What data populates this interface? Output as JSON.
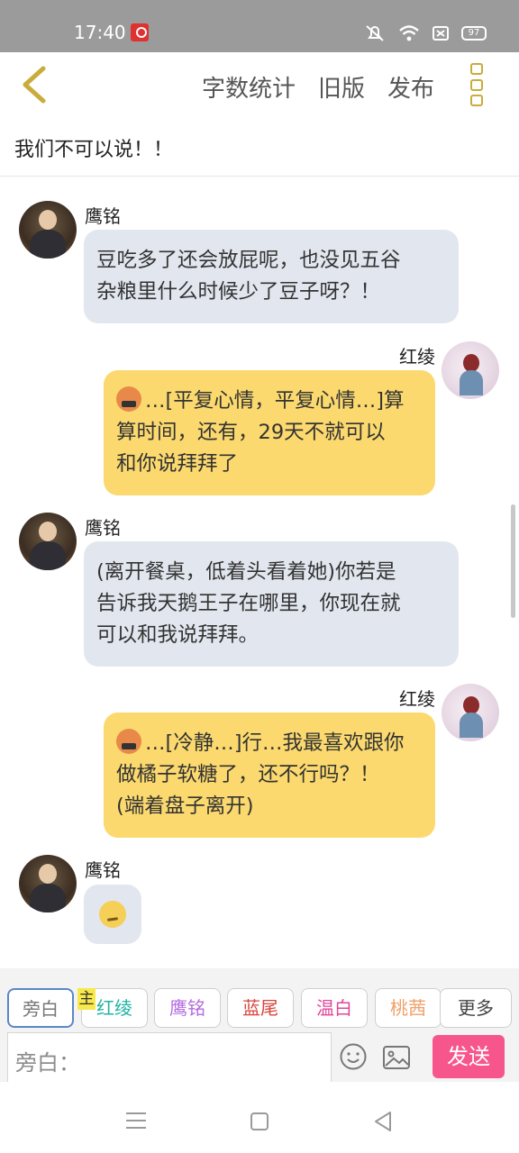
{
  "status_bar": {
    "time": "17:40",
    "battery": "97",
    "icons": [
      "app-notification-icon",
      "mute-icon",
      "wifi-icon",
      "sim-icon",
      "battery-icon"
    ]
  },
  "nav": {
    "word_count": "字数统计",
    "old_version": "旧版",
    "publish": "发布"
  },
  "title": "我们不可以说！！",
  "messages": [
    {
      "side": "left",
      "name": "鹰铭",
      "lines": [
        "豆吃多了还会放屁呢，也没见五谷",
        "杂粮里什么时候少了豆子呀？！"
      ]
    },
    {
      "side": "right",
      "name": "红绫",
      "emoji": "angry-emoji",
      "lines": [
        "…[平复心情，平复心情…]算",
        "算时间，还有，29天不就可以",
        "和你说拜拜了"
      ]
    },
    {
      "side": "left",
      "name": "鹰铭",
      "lines": [
        "(离开餐桌，低着头看着她)你若是",
        "告诉我天鹅王子在哪里，你现在就",
        "可以和我说拜拜。"
      ]
    },
    {
      "side": "right",
      "name": "红绫",
      "emoji": "angry-emoji",
      "lines": [
        "…[冷静…]行…我最喜欢跟你",
        "做橘子软糖了，还不行吗？！",
        "(端着盘子离开)"
      ]
    },
    {
      "side": "left",
      "name": "鹰铭",
      "emoji": "smirk-emoji",
      "lines": []
    }
  ],
  "roles": [
    {
      "label": "旁白",
      "color": "#777777"
    },
    {
      "label": "红绫",
      "color": "#22b3a4"
    },
    {
      "label": "鹰铭",
      "color": "#b46be0"
    },
    {
      "label": "蓝尾",
      "color": "#d8443a"
    },
    {
      "label": "温白",
      "color": "#e0479a"
    },
    {
      "label": "桃茜",
      "color": "#f0a06a"
    },
    {
      "label": "更多",
      "color": "#444444"
    }
  ],
  "master_badge": "主",
  "input": {
    "placeholder": "旁白："
  },
  "send": "发送",
  "colors": {
    "accent_pink": "#f7568d",
    "bubble_left": "#e2e7ef",
    "bubble_right": "#fbd96e",
    "nav_accent": "#c9ac3c"
  }
}
